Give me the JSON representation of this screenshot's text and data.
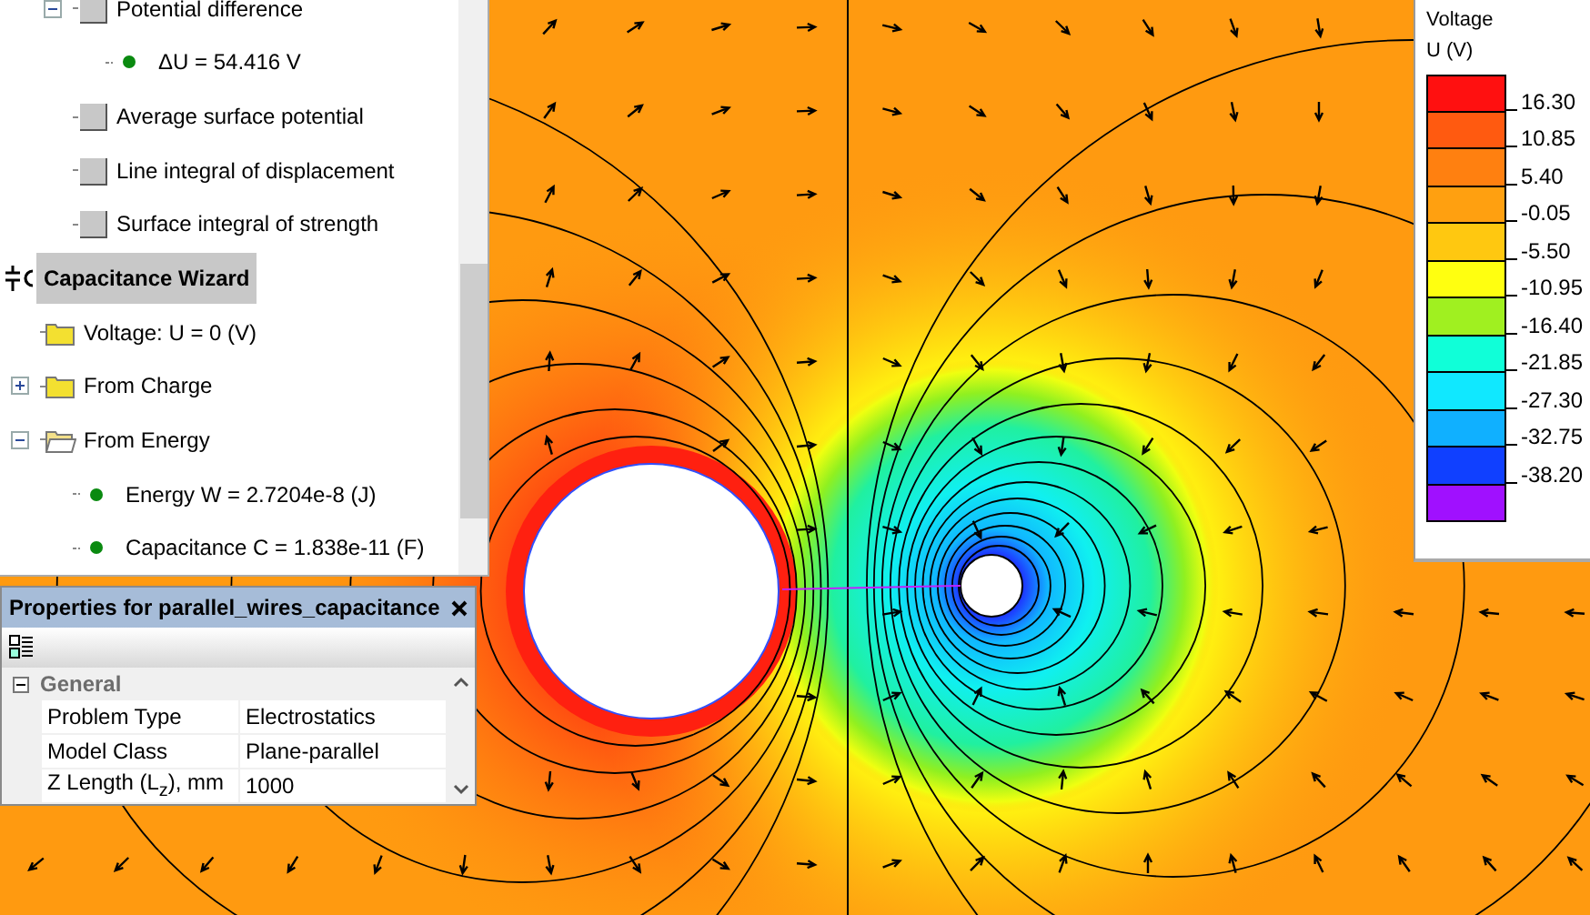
{
  "tree": {
    "partial_branch": [
      {
        "label": "Potential difference",
        "kind": "quantity",
        "expanded": true,
        "selected": false,
        "children": [
          {
            "label": "ΔU = 54.416 V",
            "kind": "result",
            "selected": false
          }
        ]
      },
      {
        "label": "Average surface potential",
        "kind": "quantity",
        "selected": false
      },
      {
        "label": "Line integral of displacement",
        "kind": "quantity",
        "selected": false
      },
      {
        "label": "Surface integral of strength",
        "kind": "quantity",
        "selected": false
      }
    ],
    "items": [
      {
        "label": "Capacitance Wizard",
        "kind": "wizard",
        "selected": true,
        "children": [
          {
            "label": "Voltage: U = 0 (V)",
            "kind": "folder",
            "selected": false
          },
          {
            "label": "From Charge",
            "kind": "folder",
            "expanded": false,
            "selected": false
          },
          {
            "label": "From Energy",
            "kind": "folder",
            "expanded": true,
            "selected": false,
            "children": [
              {
                "label": "Energy W = 2.7204e-8 (J)",
                "kind": "result",
                "selected": false
              },
              {
                "label": "Capacitance C = 1.838e-11 (F)",
                "kind": "result",
                "selected": false
              }
            ]
          }
        ]
      }
    ]
  },
  "properties": {
    "title": "Properties for parallel_wires_capacitance",
    "category": {
      "label": "General",
      "expanded": true
    },
    "rows": [
      {
        "name": "Problem Type",
        "value": "Electrostatics"
      },
      {
        "name": "Model Class",
        "value": "Plane-parallel"
      },
      {
        "name": "Z Length (L$_{z}$), mm",
        "value": "1000"
      }
    ]
  },
  "legend": {
    "title": "Voltage",
    "unit": "U (V)",
    "bands": [
      {
        "color": "#ff1010",
        "label": "16.30"
      },
      {
        "color": "#ff5a10",
        "label": "10.85"
      },
      {
        "color": "#ff8010",
        "label": "5.40"
      },
      {
        "color": "#ffa010",
        "label": "-0.05"
      },
      {
        "color": "#ffc810",
        "label": "-5.50"
      },
      {
        "color": "#ffff10",
        "label": "-10.95"
      },
      {
        "color": "#a0f020",
        "label": "-16.40"
      },
      {
        "color": "#10ffd8",
        "label": "-21.85"
      },
      {
        "color": "#10e8ff",
        "label": "-27.30"
      },
      {
        "color": "#10b0ff",
        "label": "-32.75"
      },
      {
        "color": "#1040ff",
        "label": "-38.20"
      },
      {
        "color": "#a010ff"
      }
    ]
  }
}
